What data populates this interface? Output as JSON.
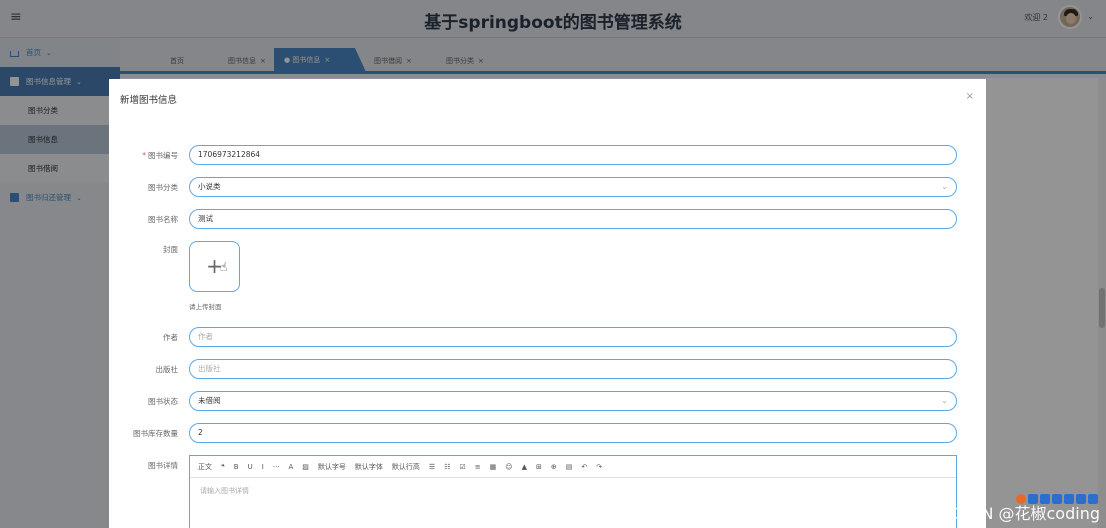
{
  "header": {
    "title": "基于springboot的图书管理系统",
    "welcome": "欢迎 2",
    "caret": "⌄"
  },
  "sidebar": {
    "items": [
      {
        "label": "首页",
        "type": "top"
      },
      {
        "label": "图书信息管理",
        "type": "group"
      },
      {
        "label": "图书分类",
        "type": "sub"
      },
      {
        "label": "图书信息",
        "type": "sub",
        "active": true
      },
      {
        "label": "图书借阅",
        "type": "sub"
      },
      {
        "label": "图书归还管理",
        "type": "group2"
      }
    ]
  },
  "tabs": [
    {
      "label": "首页"
    },
    {
      "label": "图书信息",
      "close": "×"
    },
    {
      "label": "● 图书信息",
      "close": "×",
      "active": true
    },
    {
      "label": "图书借阅",
      "close": "×"
    },
    {
      "label": "图书分类",
      "close": "×"
    }
  ],
  "dialog": {
    "title": "新增图书信息",
    "close": "×",
    "fields": {
      "book_no": {
        "label": "图书编号",
        "value": "1706973212864",
        "required": "*"
      },
      "category": {
        "label": "图书分类",
        "value": "小说类",
        "arrow": "⌄"
      },
      "name": {
        "label": "图书名称",
        "value": "测试"
      },
      "cover": {
        "label": "封面",
        "tip": "请上传封面"
      },
      "author": {
        "label": "作者",
        "placeholder": "作者"
      },
      "publisher": {
        "label": "出版社",
        "placeholder": "出版社"
      },
      "status": {
        "label": "图书状态",
        "value": "未借阅",
        "arrow": "⌄"
      },
      "stock": {
        "label": "图书库存数量",
        "value": "2"
      },
      "details": {
        "label": "图书详情",
        "placeholder": "请输入图书详情"
      }
    },
    "editor_toolbar": [
      "正文",
      "❝",
      "B",
      "U",
      "I",
      "···",
      "A",
      "▨",
      "默认字号",
      "默认字体",
      "默认行高",
      "☰",
      "☷",
      "☑",
      "≡",
      "▦",
      "☺",
      "▲",
      "⊞",
      "⊕",
      "▤",
      "↶",
      "↷"
    ]
  },
  "watermark": "CSDN @花椒coding"
}
